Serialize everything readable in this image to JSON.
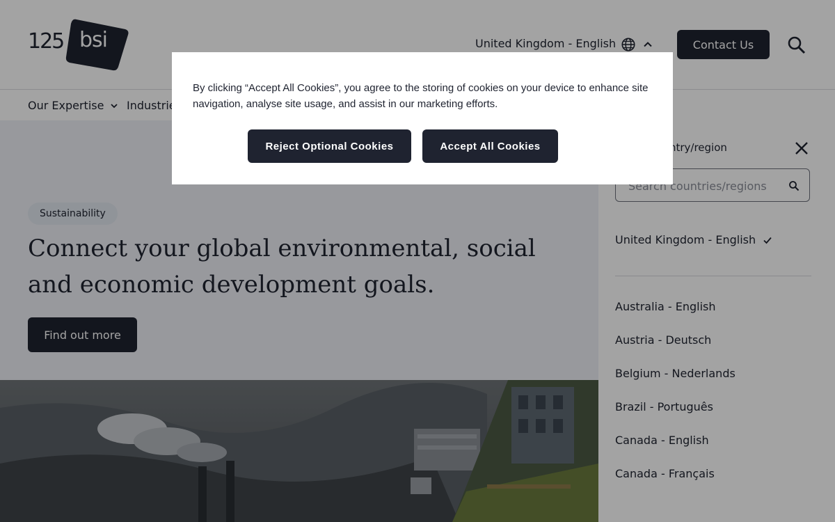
{
  "header": {
    "logo_number": "125",
    "logo_text": "bsi",
    "locale_label": "United Kingdom - English",
    "contact_label": "Contact Us"
  },
  "nav": {
    "items": [
      {
        "label": "Our Expertise"
      },
      {
        "label": "Industries"
      }
    ]
  },
  "hero": {
    "tag": "Sustainability",
    "headline": "Connect your global environmental, social and economic development goals.",
    "cta_label": "Find out more"
  },
  "country_panel": {
    "title": "Select country/region",
    "search_placeholder": "Search countries/regions",
    "current": "United Kingdom - English",
    "countries": [
      "Australia - English",
      "Austria - Deutsch",
      "Belgium - Nederlands",
      "Brazil - Português",
      "Canada - English",
      "Canada - Français"
    ]
  },
  "cookie_banner": {
    "message": "By clicking “Accept All Cookies”, you agree to the storing of cookies on your device to enhance site navigation, analyse site usage, and assist in our marketing efforts.",
    "reject_label": "Reject Optional Cookies",
    "accept_label": "Accept All Cookies"
  },
  "colors": {
    "primary": "#1f2330",
    "hero_bg": "#eef0f6",
    "tag_bg": "#e2e8f0",
    "overlay": "rgba(0,0,0,0.36)"
  }
}
